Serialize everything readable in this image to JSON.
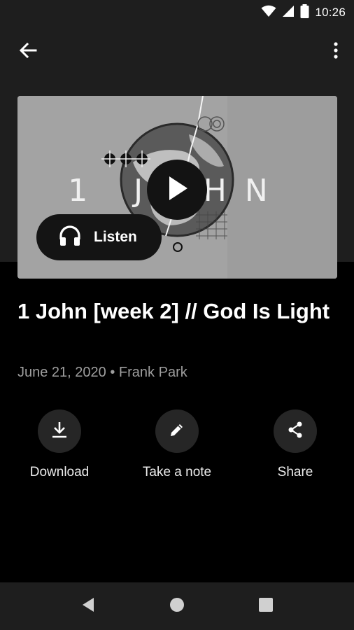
{
  "status_bar": {
    "time": "10:26",
    "icons": [
      "wifi-icon",
      "cell-signal-icon",
      "battery-icon"
    ]
  },
  "app_bar": {
    "back_icon": "arrow-left-icon",
    "menu_icon": "more-vertical-icon"
  },
  "artwork": {
    "title_text": "1 JOHN",
    "play_icon": "play-icon"
  },
  "listen": {
    "label": "Listen",
    "icon": "headphones-icon"
  },
  "sermon": {
    "title": "1 John [week 2] // God Is Light",
    "date": "June 21, 2020",
    "separator": "•",
    "speaker": "Frank Park"
  },
  "actions": [
    {
      "label": "Download",
      "icon": "download-icon"
    },
    {
      "label": "Take a note",
      "icon": "pencil-icon"
    },
    {
      "label": "Share",
      "icon": "share-icon"
    }
  ],
  "nav_bar": {
    "icons": [
      "back-triangle-icon",
      "home-circle-icon",
      "recents-square-icon"
    ]
  },
  "colors": {
    "background": "#000000",
    "surface": "#1e1e1e",
    "action_circle": "#262626",
    "meta_text": "#9e9e9e"
  }
}
